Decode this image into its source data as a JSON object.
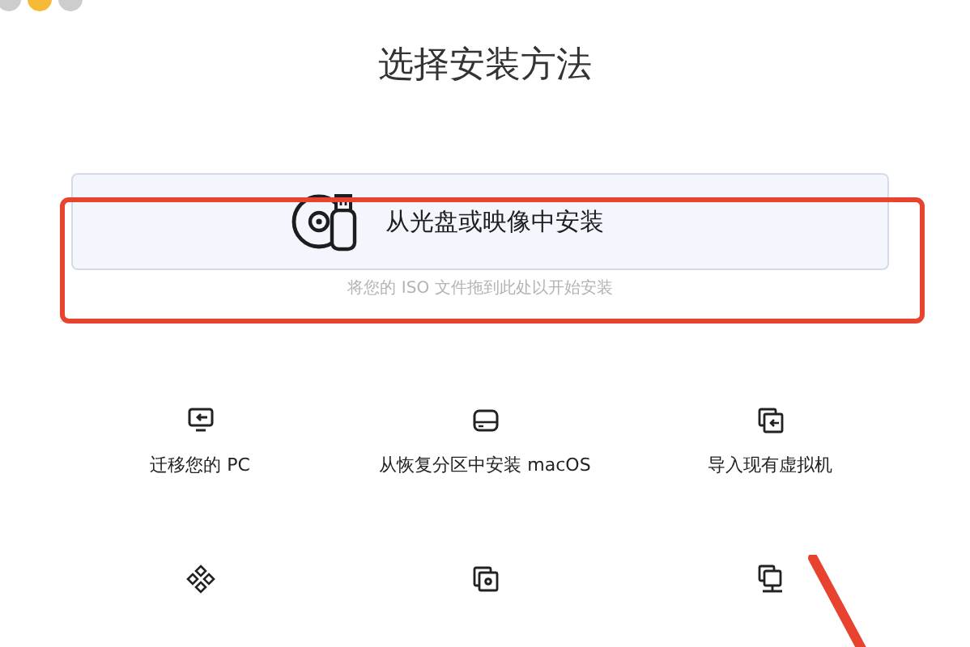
{
  "window": {
    "buttons": [
      {
        "color": "#cdcdcd"
      },
      {
        "color": "#f5bb36"
      },
      {
        "color": "#cdcdcd"
      }
    ]
  },
  "title": "选择安装方法",
  "primary_option": {
    "label": "从光盘或映像中安装",
    "hint": "将您的 ISO 文件拖到此处以开始安装"
  },
  "options": [
    {
      "kind": "migrate",
      "label": "迁移您的 PC"
    },
    {
      "kind": "recovery",
      "label": "从恢复分区中安装 macOS"
    },
    {
      "kind": "import",
      "label": "导入现有虚拟机"
    },
    {
      "kind": "diamond"
    },
    {
      "kind": "copies"
    },
    {
      "kind": "network"
    }
  ]
}
